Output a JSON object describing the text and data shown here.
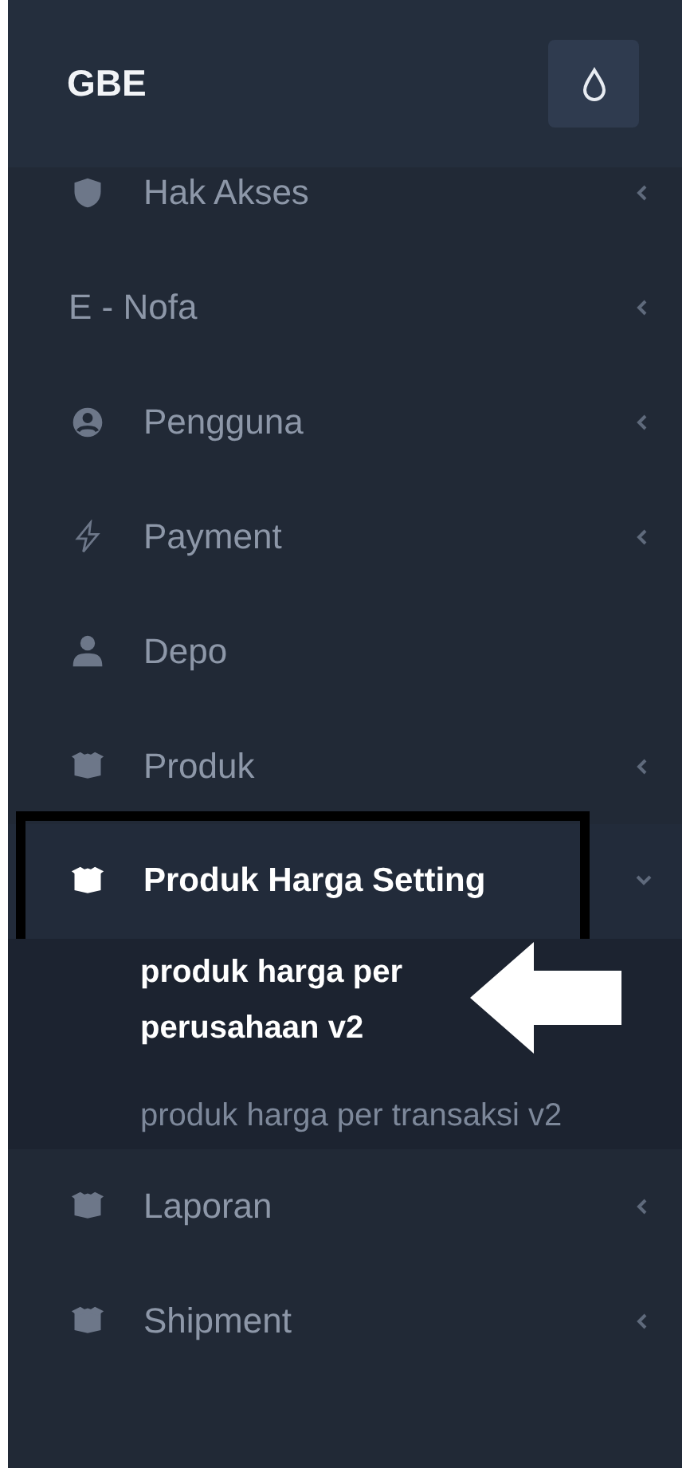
{
  "sidebar": {
    "brand": "GBE",
    "items": [
      {
        "label": "Hak Akses",
        "expanded": false,
        "selected": false,
        "highlighted": false
      },
      {
        "label": "E - Nofa",
        "expanded": false,
        "selected": false,
        "highlighted": false
      },
      {
        "label": "Pengguna",
        "expanded": false,
        "selected": false,
        "highlighted": false
      },
      {
        "label": "Payment",
        "expanded": false,
        "selected": false,
        "highlighted": false
      },
      {
        "label": "Depo",
        "selected": false,
        "highlighted": false
      },
      {
        "label": "Produk",
        "expanded": false,
        "selected": false,
        "highlighted": false
      },
      {
        "label": "Produk Harga Setting",
        "expanded": true,
        "selected": true,
        "highlighted": true,
        "children": [
          {
            "label": "produk harga per perusahaan v2",
            "selected": true,
            "pointed": true
          },
          {
            "label": "produk harga per transaksi v2",
            "selected": false,
            "pointed": false
          }
        ]
      },
      {
        "label": "Laporan",
        "expanded": false,
        "selected": false,
        "highlighted": false
      },
      {
        "label": "Shipment",
        "expanded": false,
        "selected": false,
        "highlighted": false
      }
    ]
  }
}
